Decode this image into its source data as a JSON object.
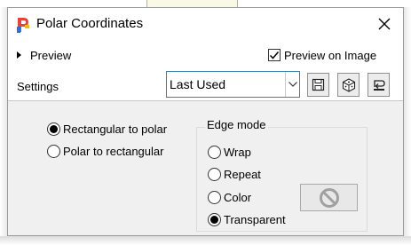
{
  "window": {
    "title": "Polar Coordinates"
  },
  "preview": {
    "toggle_label": "Preview",
    "on_image_label": "Preview on Image",
    "on_image_checked": true
  },
  "settings": {
    "label": "Settings",
    "preset_value": "Last Used",
    "toolbar_icons": [
      "save-preset-icon",
      "randomize-icon",
      "reset-icon"
    ]
  },
  "mode": {
    "options": [
      {
        "label": "Rectangular to polar",
        "selected": true
      },
      {
        "label": "Polar to rectangular",
        "selected": false
      }
    ]
  },
  "edge_mode": {
    "title": "Edge mode",
    "options": [
      {
        "label": "Wrap",
        "selected": false
      },
      {
        "label": "Repeat",
        "selected": false
      },
      {
        "label": "Color",
        "selected": false
      },
      {
        "label": "Transparent",
        "selected": true
      }
    ],
    "color_swatch_icon": "no-color-icon"
  },
  "colors": {
    "combo_border": "#3c7fb1",
    "panel_bg": "#f0f0f0",
    "app_icon_red": "#e8423b",
    "app_icon_blue": "#2f6fd4"
  }
}
